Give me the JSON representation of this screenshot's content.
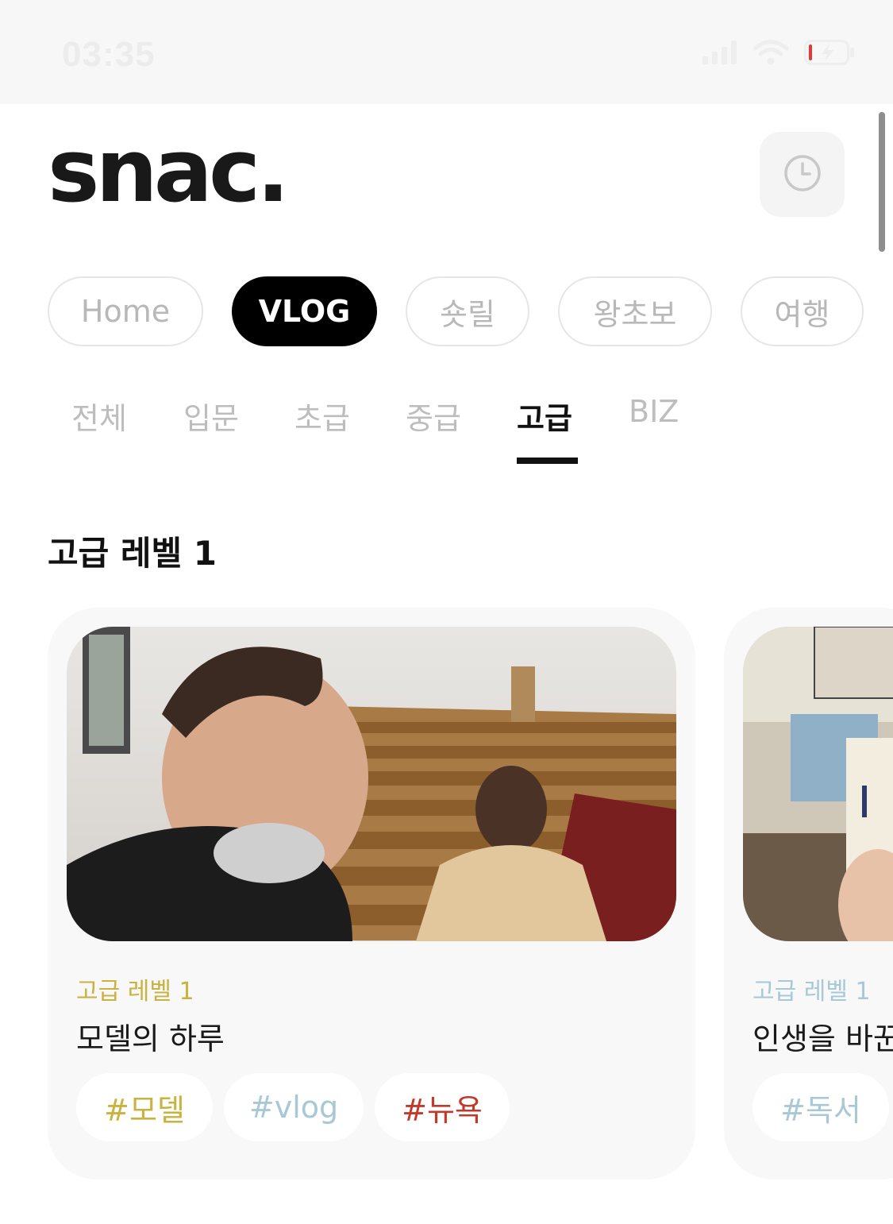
{
  "status_bar": {
    "time": "03:35",
    "signal_icon": "cellular-signal-icon",
    "wifi_icon": "wifi-icon",
    "battery_icon": "battery-charging-icon",
    "battery_level": 0.08
  },
  "header": {
    "logo": "snac.",
    "history_icon": "clock-icon"
  },
  "category_tabs": [
    {
      "label": "Home",
      "active": false
    },
    {
      "label": "VLOG",
      "active": true
    },
    {
      "label": "숏릴",
      "active": false
    },
    {
      "label": "왕초보",
      "active": false
    },
    {
      "label": "여행",
      "active": false
    }
  ],
  "level_tabs": [
    {
      "label": "전체",
      "active": false
    },
    {
      "label": "입문",
      "active": false
    },
    {
      "label": "초급",
      "active": false
    },
    {
      "label": "중급",
      "active": false
    },
    {
      "label": "고급",
      "active": true
    },
    {
      "label": "BIZ",
      "active": false
    }
  ],
  "section": {
    "title": "고급 레벨 1"
  },
  "cards": [
    {
      "level": "고급 레벨 1",
      "level_color": "#c9b23e",
      "title": "모델의 하루",
      "tags": [
        {
          "text": "#모델",
          "color": "#c9b23e"
        },
        {
          "text": "#vlog",
          "color": "#a8c8d6"
        },
        {
          "text": "#뉴욕",
          "color": "#c0392b"
        }
      ]
    },
    {
      "level": "고급 레벨 1",
      "level_color": "#a8c8d6",
      "title": "인생을 바꾼",
      "tags": [
        {
          "text": "#독서",
          "color": "#a8c8d6"
        }
      ]
    }
  ],
  "colors": {
    "active_tab_bg": "#000000",
    "inactive_text": "#b8b8b8",
    "card_bg": "#f8f8f9"
  }
}
